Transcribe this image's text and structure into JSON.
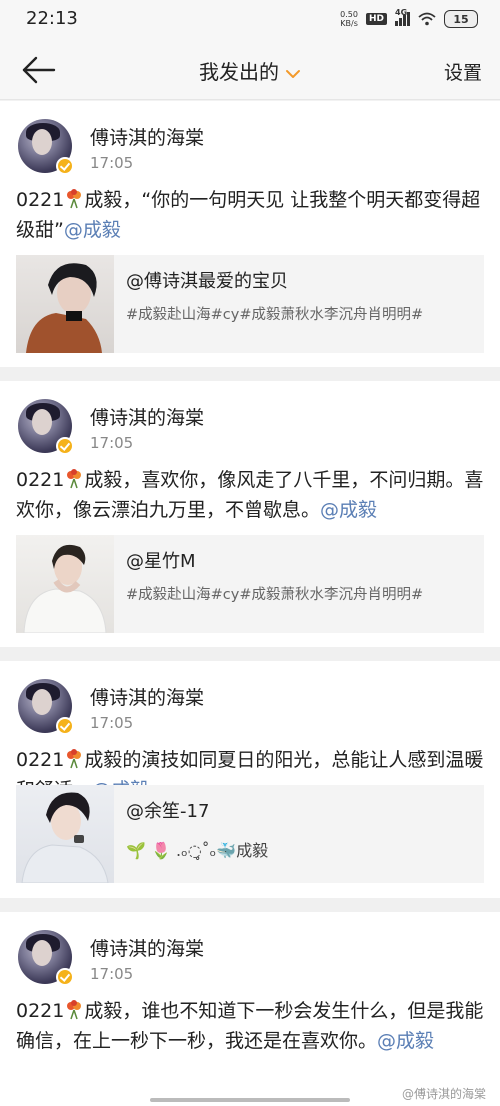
{
  "status": {
    "time": "22:13",
    "net_speed_value": "0.50",
    "net_speed_unit": "KB/s",
    "hd": "HD",
    "network": "4G",
    "battery": "15"
  },
  "nav": {
    "title": "我发出的",
    "settings_label": "设置"
  },
  "posts": [
    {
      "user": "傅诗淇的海棠",
      "time": "17:05",
      "text_prefix": "0221",
      "text_body": "成毅，“你的一句明天见 让我整个明天都变得超级甜”",
      "mention": "@成毅",
      "quote_user": "@傅诗淇最爱的宝贝",
      "quote_tags": "#成毅赴山海#cy#成毅萧秋水李沉舟肖明明#"
    },
    {
      "user": "傅诗淇的海棠",
      "time": "17:05",
      "text_prefix": "0221",
      "text_body": "成毅，喜欢你，像风走了八千里，不问归期。喜欢你，像云漂泊九万里，不曾歇息。",
      "mention": "@成毅",
      "quote_user": "@星竹M",
      "quote_tags": "#成毅赴山海#cy#成毅萧秋水李沉舟肖明明#"
    },
    {
      "user": "傅诗淇的海棠",
      "time": "17:05",
      "text_prefix": "0221",
      "text_body": "成毅的演技如同夏日的阳光，总能让人感到温暖和舒适。",
      "mention": "@成毅",
      "quote_user": "@余笙-17",
      "quote_tags": "🌱 🌷 .ₒ◌̥˚ₒ🐳成毅"
    },
    {
      "user": "傅诗淇的海棠",
      "time": "17:05",
      "text_prefix": "0221",
      "text_body": "成毅，谁也不知道下一秒会发生什么，但是我能确信，在上一秒下一秒，我还是在喜欢你。",
      "mention": "@成毅"
    }
  ],
  "watermark": "@傅诗淇的海棠",
  "icons": {
    "back": "back-arrow-icon",
    "dropdown": "chevron-down-icon",
    "flower": "flower-bouquet-icon",
    "verified": "verified-badge-icon"
  },
  "colors": {
    "accent": "#f39a2b",
    "mention": "#5b7fb5",
    "vip": "#f5b21b"
  }
}
